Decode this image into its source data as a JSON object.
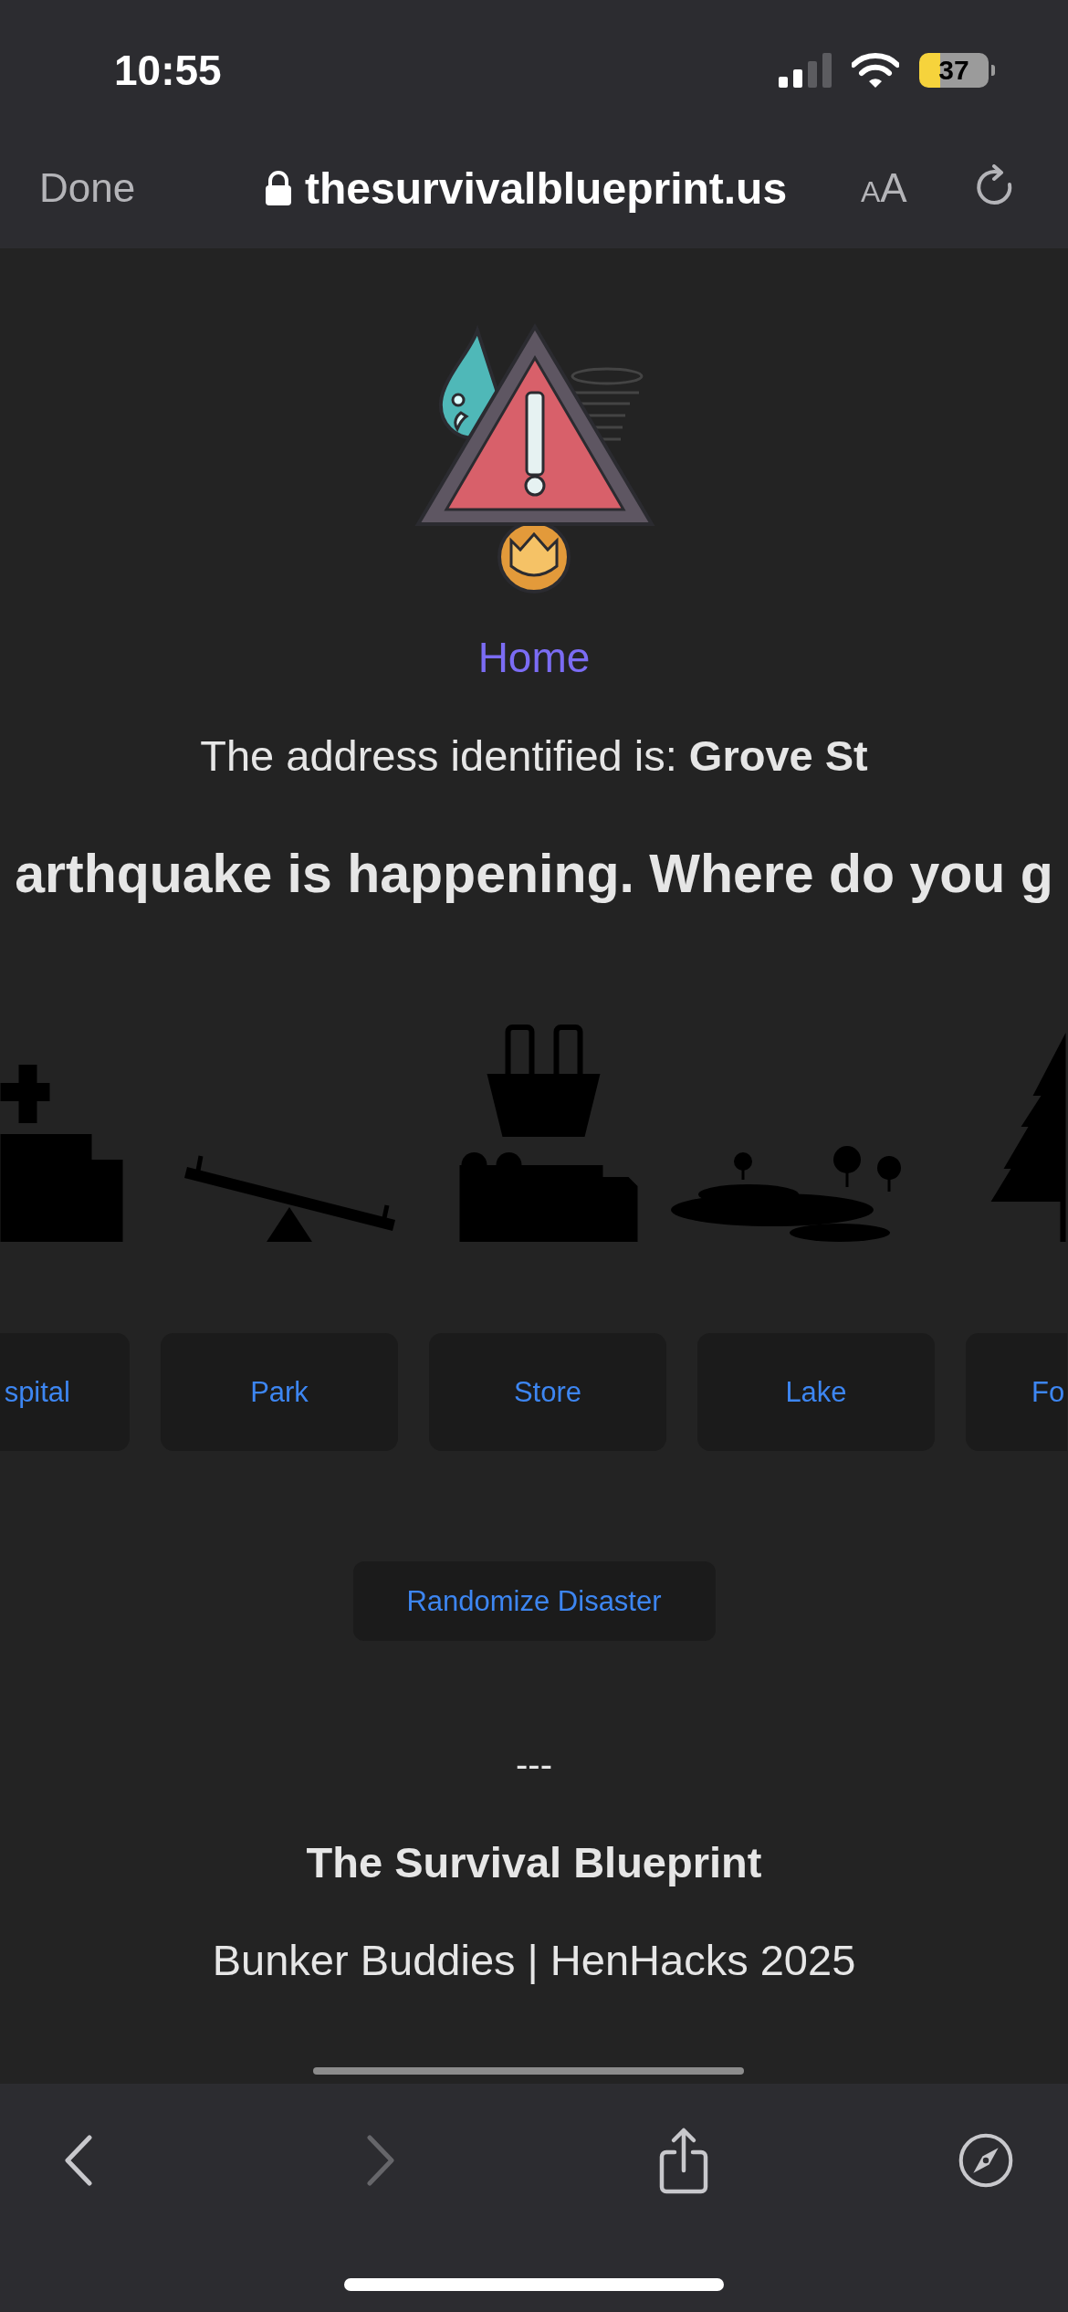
{
  "status_bar": {
    "time": "10:55",
    "battery": "37"
  },
  "browser_bar": {
    "done": "Done",
    "url": "thesurvivalblueprint.us",
    "text_size": "AA"
  },
  "page": {
    "home_link": "Home",
    "address": "The address identified is: **Grove St**",
    "question": "arthquake is happening. Where do you g",
    "destinations": [
      {
        "kind": "hospital",
        "label": "spital"
      },
      {
        "kind": "park",
        "label": "Park"
      },
      {
        "kind": "store",
        "label": "Store"
      },
      {
        "kind": "lake",
        "label": "Lake"
      },
      {
        "kind": "forest",
        "label": "Fo"
      }
    ],
    "randomize_button": "Randomize Disaster"
  },
  "footer": {
    "separator": "---",
    "title": "The Survival Blueprint",
    "credits": "Bunker Buddies | HenHacks 2025"
  },
  "toolbar": {
    "back": {
      "disabled": false
    },
    "forward": {
      "disabled": true
    }
  }
}
